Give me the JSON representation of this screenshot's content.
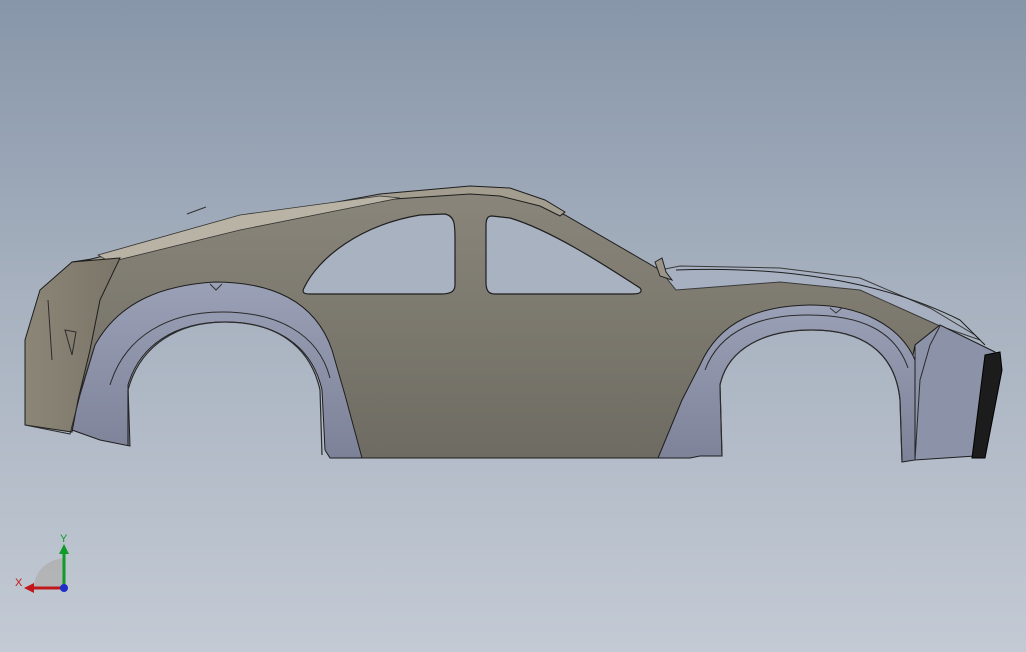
{
  "viewport": {
    "background_top": "#8796a9",
    "background_bottom": "#c3cad4"
  },
  "model": {
    "body_color": "#7e7a70",
    "panel_color": "#8e93a8",
    "edge_color": "#1e1e1e"
  },
  "triad": {
    "x_label": "X",
    "y_label": "Y",
    "x_color": "#c0181a",
    "y_color": "#109a2a",
    "z_color": "#1f2fc8"
  }
}
